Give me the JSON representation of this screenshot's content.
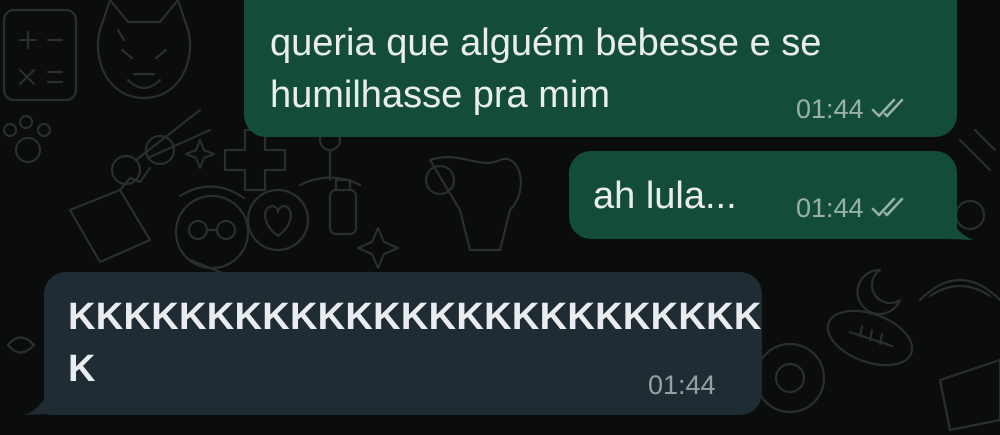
{
  "conversation": {
    "messages": [
      {
        "direction": "outgoing",
        "lines": [
          "queria que alguém bebesse e se",
          "humilhasse pra mim"
        ],
        "time": "01:44",
        "status_icon": "double-check-icon"
      },
      {
        "direction": "outgoing",
        "lines": [
          "ah lula..."
        ],
        "time": "01:44",
        "status_icon": "double-check-icon"
      },
      {
        "direction": "incoming",
        "lines": [
          "KKKKKKKKKKKKKKKKKKKKKKKKK",
          "K"
        ],
        "time": "01:44"
      }
    ]
  },
  "colors": {
    "background": "#0b0d0c",
    "outgoing_bubble": "#134d37",
    "incoming_bubble": "#202c33",
    "text": "#e9edef",
    "meta_text": "#9aa4a1"
  }
}
